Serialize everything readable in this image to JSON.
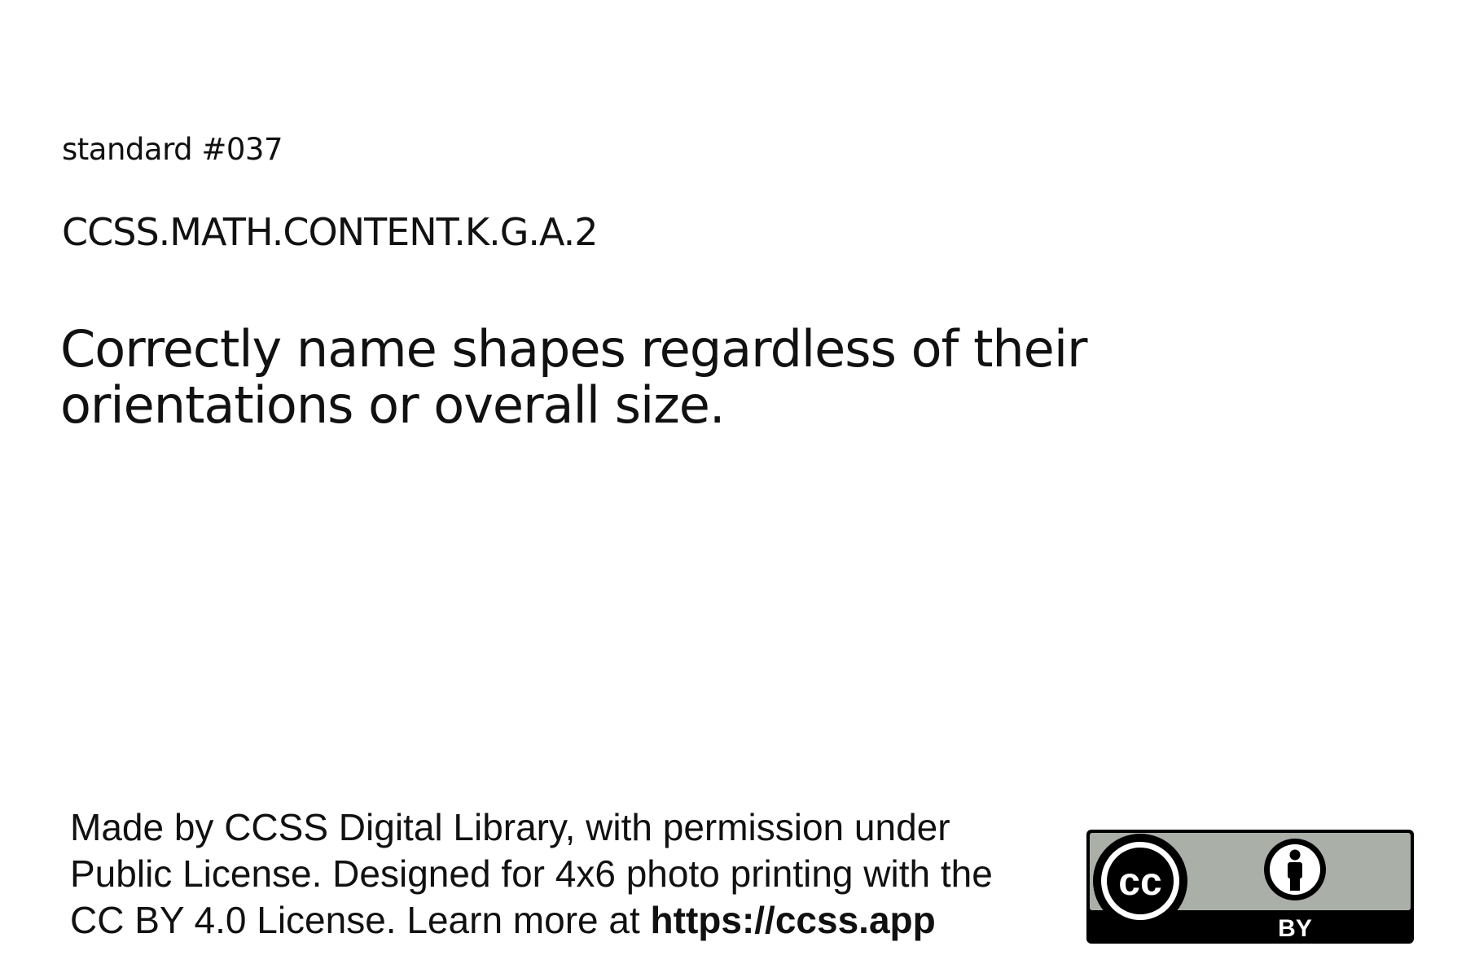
{
  "standard": {
    "number": "standard #037",
    "code": "CCSS.MATH.CONTENT.K.G.A.2",
    "text_lines": [
      "Correctly name shapes regardless of their",
      "orientations or overall size."
    ]
  },
  "attribution": {
    "line1": "Made by CCSS Digital Library, with permission under",
    "line2": "Public License. Designed for 4x6 photo printing with the",
    "line3_prefix": "CC BY 4.0 License. Learn more at ",
    "link": "https://ccss.app"
  },
  "license_badge": {
    "cc_text": "cc",
    "by_text": "BY",
    "icons": [
      "creative-commons-icon",
      "attribution-person-icon"
    ],
    "colors": {
      "top": "#aab0a8",
      "bottom": "#000000",
      "icon_fill": "#ffffff"
    }
  }
}
